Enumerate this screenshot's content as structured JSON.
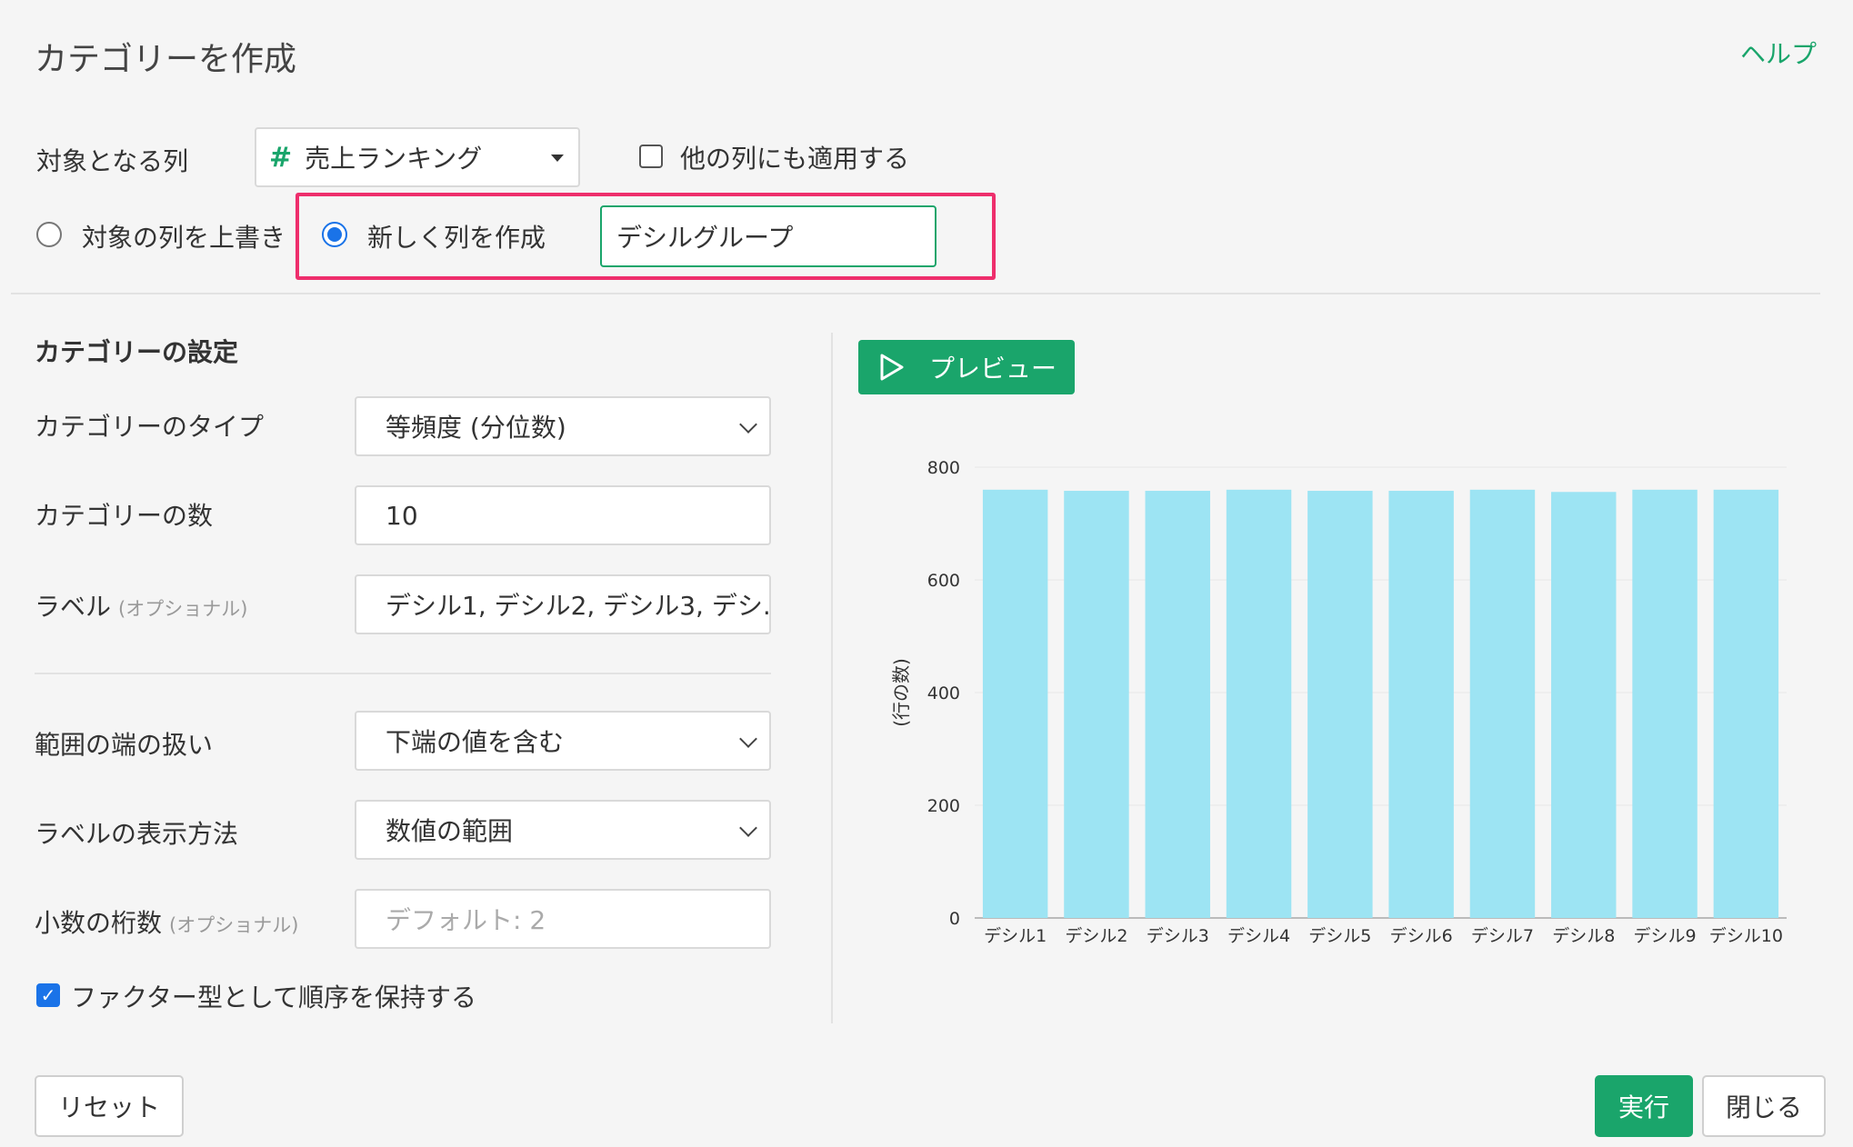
{
  "dialog": {
    "title": "カテゴリーを作成",
    "help": "ヘルプ"
  },
  "target": {
    "label": "対象となる列",
    "column": "売上ランキング",
    "apply_other_label": "他の列にも適用する",
    "apply_other_checked": false,
    "overwrite_label": "対象の列を上書き",
    "overwrite_selected": false,
    "new_col_label": "新しく列を作成",
    "new_col_selected": true,
    "new_col_name": "デシルグループ"
  },
  "settings": {
    "title": "カテゴリーの設定",
    "type_label": "カテゴリーのタイプ",
    "type_value": "等頻度 (分位数)",
    "count_label": "カテゴリーの数",
    "count_value": "10",
    "labels_label": "ラベル",
    "optional": "(オプショナル)",
    "labels_value": "デシル1, デシル2, デシル3, デシ.",
    "edge_label": "範囲の端の扱い",
    "edge_value": "下端の値を含む",
    "display_label": "ラベルの表示方法",
    "display_value": "数値の範囲",
    "decimal_label": "小数の桁数",
    "decimal_placeholder": "デフォルト: 2",
    "factor_label": "ファクター型として順序を保持する",
    "factor_checked": true
  },
  "preview": {
    "button": "プレビュー"
  },
  "footer": {
    "reset": "リセット",
    "run": "実行",
    "close": "閉じる"
  },
  "colors": {
    "accent": "#1aa56b",
    "highlight": "#ee2e6c",
    "bar": "#9de4f3",
    "radio": "#1a73e8"
  },
  "chart_data": {
    "type": "bar",
    "categories": [
      "デシル1",
      "デシル2",
      "デシル3",
      "デシル4",
      "デシル5",
      "デシル6",
      "デシル7",
      "デシル8",
      "デシル9",
      "デシル10"
    ],
    "values": [
      760,
      758,
      758,
      760,
      758,
      758,
      760,
      756,
      760,
      760
    ],
    "ylabel": "(行の数)",
    "ylim": [
      0,
      800
    ],
    "yticks": [
      0,
      200,
      400,
      600,
      800
    ],
    "grid": true
  }
}
